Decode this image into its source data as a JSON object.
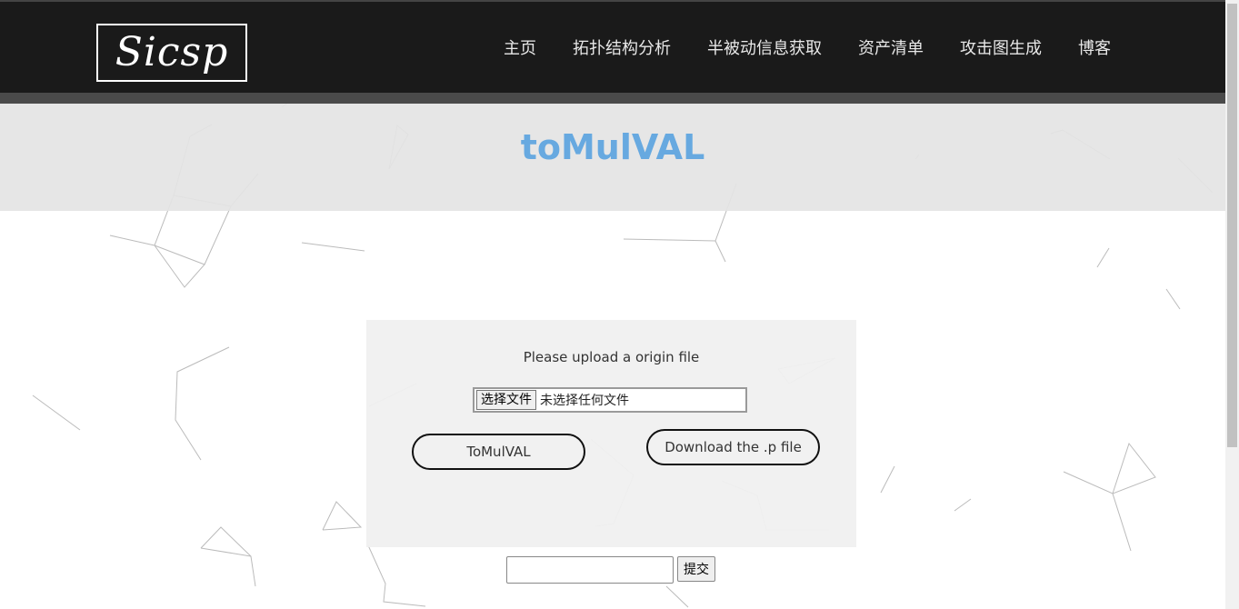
{
  "header": {
    "logo_text": "Sicsp",
    "nav": [
      "主页",
      "拓扑结构分析",
      "半被动信息获取",
      "资产清单",
      "攻击图生成",
      "博客"
    ]
  },
  "banner": {
    "title": "toMulVAL"
  },
  "upload": {
    "prompt": "Please upload a origin file",
    "file_button": "选择文件",
    "file_status": "未选择任何文件",
    "convert_button": "ToMulVAL",
    "download_button": "Download the .p file"
  },
  "submit": {
    "button": "提交",
    "value": ""
  },
  "colors": {
    "topbar": "#1a1a1a",
    "title": "#67a9e0",
    "panel": "#f0f0f0"
  }
}
